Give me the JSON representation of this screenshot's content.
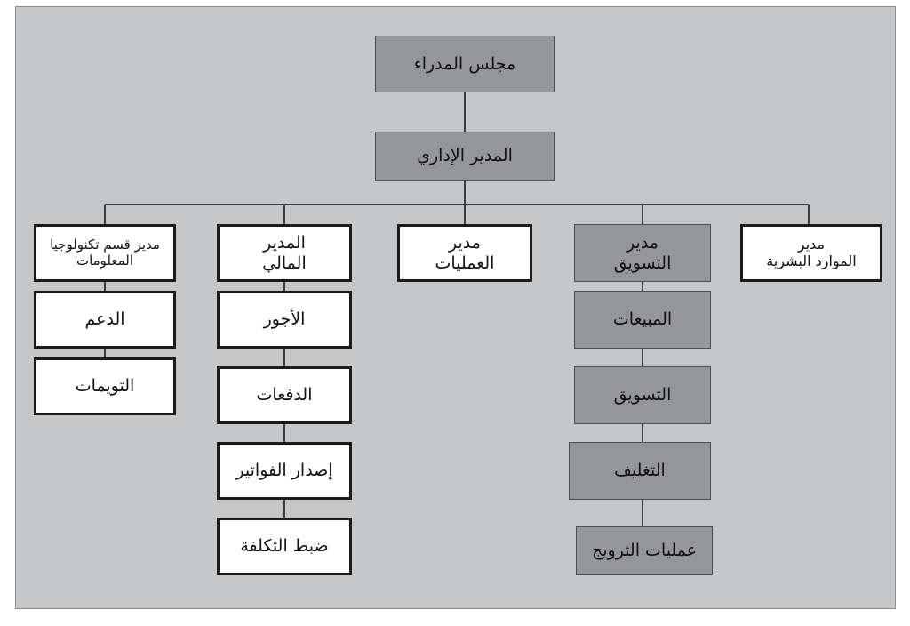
{
  "figure": {
    "kind": "organizational-chart",
    "language": "ar",
    "direction": "rtl",
    "colors": {
      "page_background": "#ffffff",
      "panel_background": "#c6c7c9",
      "panel_border": "#8b8d90",
      "box_fill_gray": "#949699",
      "box_fill_white": "#ffffff",
      "box_border_thin": "#4d4f52",
      "box_border_thick": "#1a1a1a",
      "connector_line": "#3a3c3f",
      "text": "#111111"
    }
  },
  "nodes": {
    "board": {
      "label": "مجلس المدراء",
      "style": "gray"
    },
    "admin_director": {
      "label": "المدير الإداري",
      "style": "gray"
    },
    "it_manager": {
      "label": "مدير قسم تكنولوجيا\nالمعلومات",
      "style": "white"
    },
    "it_support": {
      "label": "الدعم",
      "style": "white"
    },
    "it_assignments": {
      "label": "التويمات",
      "style": "white"
    },
    "finance_manager": {
      "label": "المدير\nالمالي",
      "style": "white"
    },
    "finance_wages": {
      "label": "الأجور",
      "style": "white"
    },
    "finance_payments": {
      "label": "الدفعات",
      "style": "white"
    },
    "finance_invoicing": {
      "label": "إصدار الفواتير",
      "style": "white"
    },
    "finance_cost_control": {
      "label": "ضبط التكلفة",
      "style": "white"
    },
    "operations_manager": {
      "label": "مدير\nالعمليات",
      "style": "white"
    },
    "marketing_manager": {
      "label": "مدير\nالتسويق",
      "style": "gray"
    },
    "marketing_sales": {
      "label": "المبيعات",
      "style": "gray"
    },
    "marketing_marketing": {
      "label": "التسويق",
      "style": "gray"
    },
    "marketing_packaging": {
      "label": "التغليف",
      "style": "gray"
    },
    "marketing_promotion": {
      "label": "عمليات الترويج",
      "style": "gray"
    },
    "hr_manager": {
      "label": "مدير\nالموارد البشرية",
      "style": "white"
    }
  },
  "hierarchy": {
    "root": "مجلس المدراء",
    "level_2": "المدير الإداري",
    "level_3": [
      "مدير قسم تكنولوجيا المعلومات",
      "المدير المالي",
      "مدير العمليات",
      "مدير التسويق",
      "مدير الموارد البشرية"
    ],
    "branches": {
      "تكنولوجيا المعلومات": [
        "الدعم",
        "التويمات"
      ],
      "المالي": [
        "الأجور",
        "الدفعات",
        "إصدار الفواتير",
        "ضبط التكلفة"
      ],
      "العمليات": [],
      "التسويق": [
        "المبيعات",
        "التسويق",
        "التغليف",
        "عمليات الترويج"
      ],
      "الموارد البشرية": []
    }
  }
}
